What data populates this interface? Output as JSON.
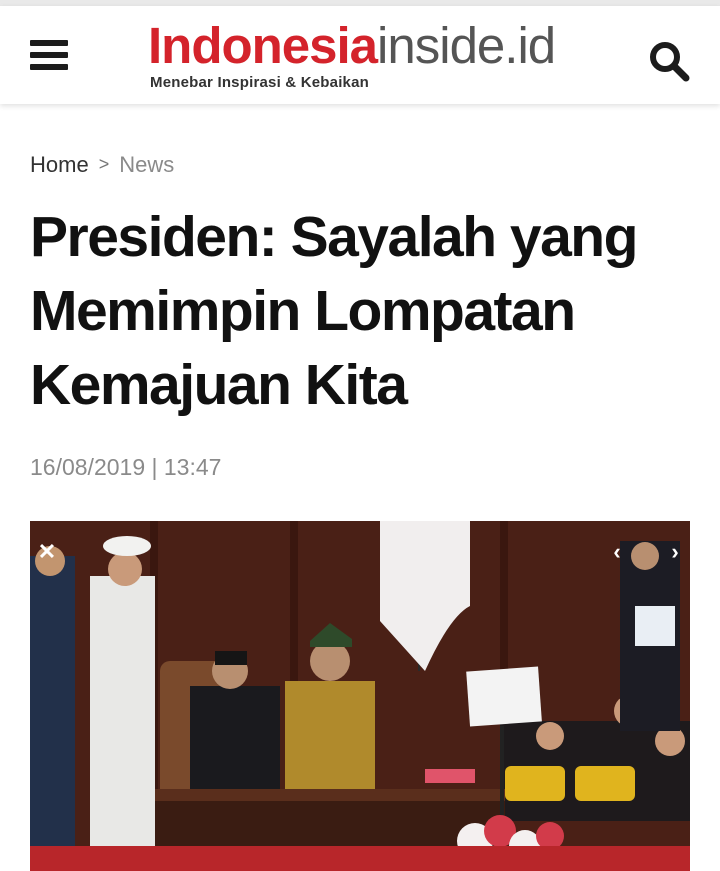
{
  "header": {
    "logo_brand": "Indonesia",
    "logo_domain": "inside.id",
    "tagline": "Menebar Inspirasi & Kebaikan",
    "menu_icon": "hamburger-icon",
    "search_icon": "search-icon",
    "brand_color": "#d4232b"
  },
  "breadcrumb": {
    "home": "Home",
    "separator": ">",
    "current": "News"
  },
  "article": {
    "title": "Presiden: Sayalah yang Memimpin Lompatan Kemajuan Kita",
    "date": "16/08/2019 | 13:47"
  },
  "gallery": {
    "close_icon": "close-icon",
    "prev_icon": "chevron-left-icon",
    "next_icon": "chevron-right-icon"
  }
}
